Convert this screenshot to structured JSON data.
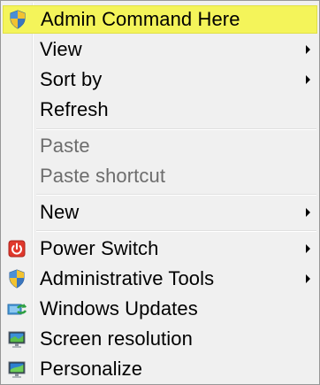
{
  "menu": {
    "items": [
      {
        "label": "Admin Command Here",
        "icon": "shield-icon",
        "submenu": false,
        "disabled": false,
        "highlighted": true
      },
      {
        "label": "View",
        "icon": "",
        "submenu": true,
        "disabled": false
      },
      {
        "label": "Sort by",
        "icon": "",
        "submenu": true,
        "disabled": false
      },
      {
        "label": "Refresh",
        "icon": "",
        "submenu": false,
        "disabled": false
      },
      {
        "label": "Paste",
        "icon": "",
        "submenu": false,
        "disabled": true
      },
      {
        "label": "Paste shortcut",
        "icon": "",
        "submenu": false,
        "disabled": true
      },
      {
        "label": "New",
        "icon": "",
        "submenu": true,
        "disabled": false
      },
      {
        "label": "Power Switch",
        "icon": "power-icon",
        "submenu": true,
        "disabled": false
      },
      {
        "label": "Administrative Tools",
        "icon": "shield-icon",
        "submenu": true,
        "disabled": false
      },
      {
        "label": "Windows Updates",
        "icon": "windows-update-icon",
        "submenu": false,
        "disabled": false
      },
      {
        "label": "Screen resolution",
        "icon": "monitor-icon",
        "submenu": false,
        "disabled": false
      },
      {
        "label": "Personalize",
        "icon": "personalize-icon",
        "submenu": false,
        "disabled": false
      }
    ]
  },
  "colors": {
    "highlight": "#f4f45a",
    "disabled_text": "#6d6d6d",
    "menu_background": "#f0f0f0"
  }
}
